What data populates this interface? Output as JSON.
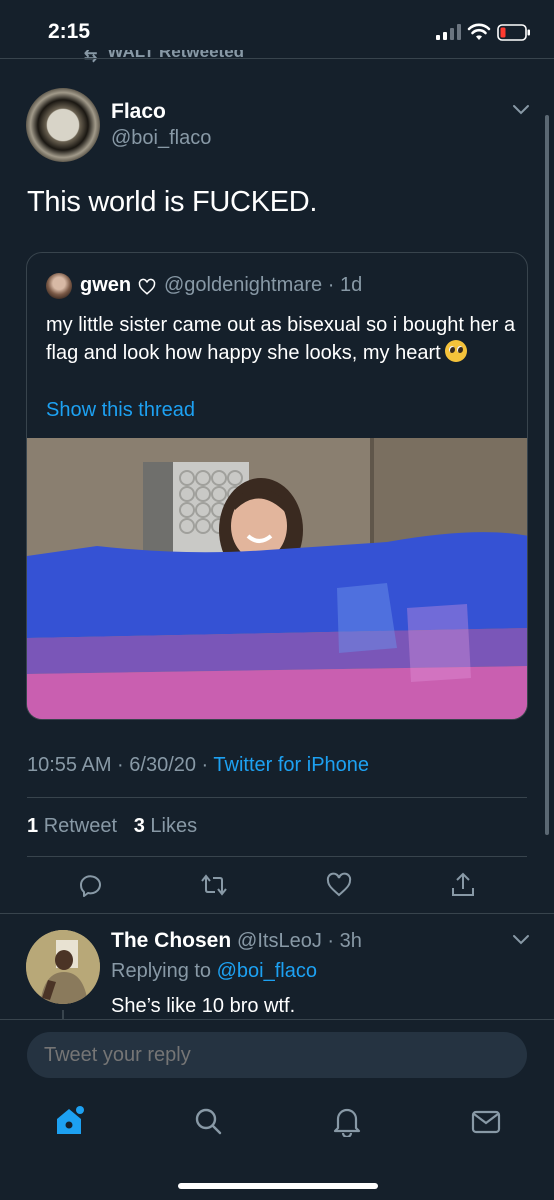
{
  "status_bar": {
    "time": "2:15"
  },
  "retweet_label": {
    "text": "WALT Retweeted"
  },
  "tweet": {
    "author_name": "Flaco",
    "author_handle": "@boi_flaco",
    "text": "This world is FUCKED.",
    "timestamp": "10:55 AM · 6/30/20 · ",
    "source": "Twitter for iPhone",
    "retweets_count": "1",
    "retweets_label": "Retweet",
    "likes_count": "3",
    "likes_label": "Likes"
  },
  "quoted_tweet": {
    "author_name": "gwen",
    "author_handle": "@goldenightmare · 1d",
    "text": "my little sister came out as bisexual so i bought her a flag and look how happy she looks, my heart",
    "show_thread": "Show this thread"
  },
  "reply": {
    "author_name": "The Chosen",
    "author_handle": "@ItsLeoJ · 3h",
    "replying_prefix": "Replying to ",
    "replying_to": "@boi_flaco",
    "text": "She’s like 10 bro wtf."
  },
  "compose": {
    "placeholder": "Tweet your reply"
  },
  "colors": {
    "background": "#15202b",
    "accent": "#1da1f2",
    "muted": "#8899a6",
    "border": "#38444d"
  },
  "icons": {
    "actions": [
      "reply-icon",
      "retweet-icon",
      "like-icon",
      "share-icon"
    ],
    "tabs": [
      "home-icon",
      "search-icon",
      "notifications-icon",
      "messages-icon"
    ]
  }
}
